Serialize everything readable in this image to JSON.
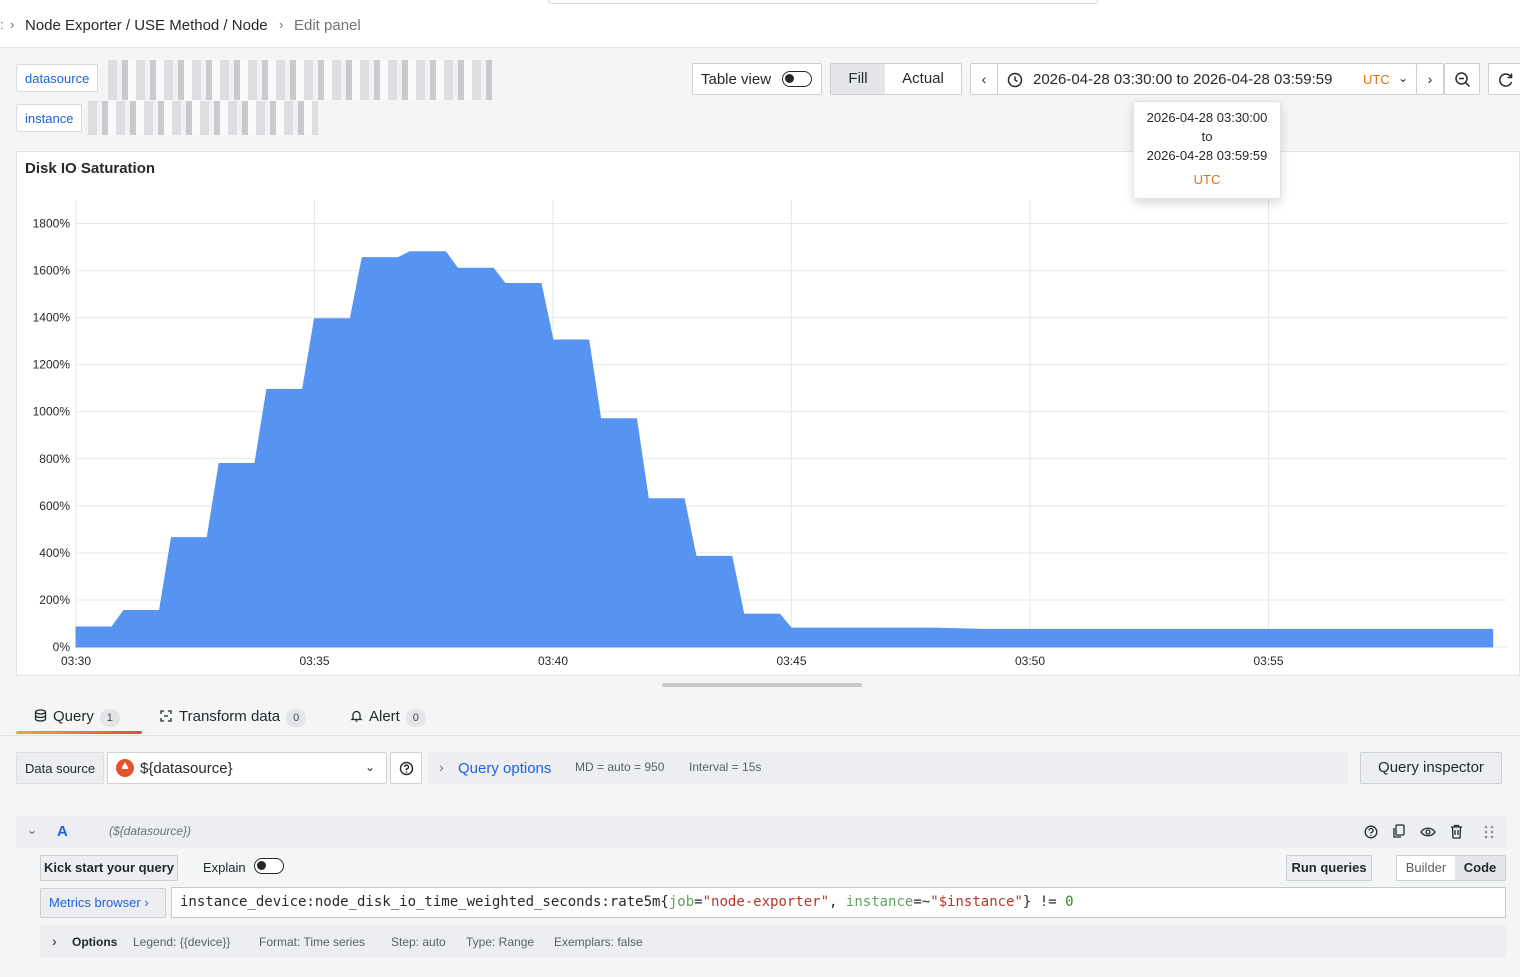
{
  "breadcrumb": {
    "items": [
      "Node Exporter / USE Method / Node",
      "Edit panel"
    ]
  },
  "variables": {
    "datasource_label": "datasource",
    "instance_label": "instance"
  },
  "toolbar": {
    "table_view_label": "Table view",
    "fill_label": "Fill",
    "actual_label": "Actual",
    "time_range": "2026-04-28 03:30:00 to 2026-04-28 03:59:59",
    "timezone": "UTC"
  },
  "tooltip": {
    "from": "2026-04-28 03:30:00",
    "to_word": "to",
    "to": "2026-04-28 03:59:59",
    "timezone": "UTC"
  },
  "panel": {
    "title": "Disk IO Saturation"
  },
  "chart_data": {
    "type": "area",
    "title": "Disk IO Saturation",
    "y_ticks": [
      "0%",
      "200%",
      "400%",
      "600%",
      "800%",
      "1000%",
      "1200%",
      "1400%",
      "1600%",
      "1800%"
    ],
    "x_ticks": [
      "03:30",
      "03:35",
      "03:40",
      "03:45",
      "03:50",
      "03:55"
    ],
    "ylim": [
      0,
      1900
    ],
    "xlim_minutes": [
      0,
      30
    ],
    "grid": true,
    "color": "#5794f2",
    "series": [
      {
        "x_minutes": [
          0,
          0.75,
          1,
          1.75,
          2,
          2.75,
          3,
          3.75,
          4,
          4.75,
          5,
          5.75,
          6,
          6.75,
          7,
          7.75,
          8,
          8.75,
          9,
          9.75,
          10,
          10.75,
          11,
          11.75,
          12,
          12.75,
          13,
          13.75,
          14,
          14.75,
          15,
          18,
          19,
          29.7
        ],
        "values": [
          85,
          85,
          155,
          155,
          465,
          465,
          780,
          780,
          1095,
          1095,
          1395,
          1395,
          1655,
          1655,
          1680,
          1680,
          1610,
          1610,
          1545,
          1545,
          1305,
          1305,
          970,
          970,
          630,
          630,
          385,
          385,
          140,
          140,
          80,
          80,
          75,
          75
        ]
      }
    ]
  },
  "tabs": [
    {
      "label": "Query",
      "count": "1"
    },
    {
      "label": "Transform data",
      "count": "0"
    },
    {
      "label": "Alert",
      "count": "0"
    }
  ],
  "datasource_row": {
    "label": "Data source",
    "value": "${datasource}",
    "query_options_label": "Query options",
    "md_info": "MD = auto = 950",
    "interval_info": "Interval = 15s",
    "inspector_label": "Query inspector"
  },
  "query": {
    "ref_id": "A",
    "datasource_hint": "(${datasource})",
    "kick_start_label": "Kick start your query",
    "explain_label": "Explain",
    "run_label": "Run queries",
    "builder_label": "Builder",
    "code_label": "Code",
    "metrics_browser_label": "Metrics browser ›",
    "expr_metric": "instance_device:node_disk_io_time_weighted_seconds:rate5m{",
    "expr_key1": "job",
    "expr_eq1": "=",
    "expr_val1": "\"node-exporter\"",
    "expr_sep": ", ",
    "expr_key2": "instance",
    "expr_eq2": "=~",
    "expr_val2": "\"$instance\"",
    "expr_close": "} != ",
    "expr_num": "0"
  },
  "options": {
    "label": "Options",
    "legend": "Legend: {{device}}",
    "format": "Format: Time series",
    "step": "Step: auto",
    "type": "Type: Range",
    "exemplars": "Exemplars: false"
  }
}
